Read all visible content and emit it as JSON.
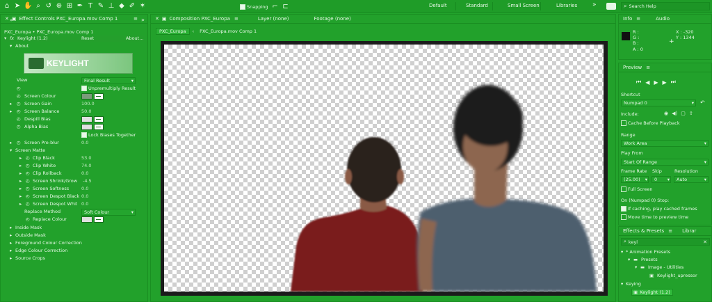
{
  "toolbar": {
    "snapping": "Snapping",
    "workspaces": [
      "Default",
      "Standard",
      "Small Screen",
      "Libraries"
    ],
    "more": "»",
    "search_placeholder": "Search Help"
  },
  "effect_controls": {
    "tab": "Effect Controls PXC_Europa.mov Comp 1",
    "breadcrumb": "PXC_Europa • PXC_Europa.mov Comp 1",
    "effect_name": "Keylight (1.2)",
    "reset": "Reset",
    "about": "About...",
    "about_label": "About",
    "logo": "KEYLIGHT",
    "view_label": "View",
    "view_value": "Final Result",
    "unpremultiply": "Unpremultiply Result",
    "screen_colour": "Screen Colour",
    "screen_gain": "Screen Gain",
    "screen_gain_val": "100.0",
    "screen_balance": "Screen Balance",
    "screen_balance_val": "50.0",
    "despill_bias": "Despill Bias",
    "alpha_bias": "Alpha Bias",
    "lock_biases": "Lock Biases Together",
    "screen_preblur": "Screen Pre-blur",
    "screen_preblur_val": "0.0",
    "screen_matte": "Screen Matte",
    "clip_black": "Clip Black",
    "clip_black_val": "53.0",
    "clip_white": "Clip White",
    "clip_white_val": "74.0",
    "clip_rollback": "Clip Rollback",
    "clip_rollback_val": "0.0",
    "screen_shrink": "Screen Shrink/Grow",
    "screen_shrink_val": "-4.5",
    "screen_softness": "Screen Softness",
    "screen_softness_val": "0.0",
    "despot_black": "Screen Despot Black",
    "despot_black_val": "0.0",
    "despot_white": "Screen Despot White",
    "despot_white_val": "0.0",
    "replace_method": "Replace Method",
    "replace_method_val": "Soft Colour",
    "replace_colour": "Replace Colour",
    "inside_mask": "Inside Mask",
    "outside_mask": "Outside Mask",
    "fg_colour_correction": "Foreground Colour Correction",
    "edge_colour_correction": "Edge Colour Correction",
    "source_crops": "Source Crops"
  },
  "composition": {
    "tab": "Composition PXC_Europa",
    "layer_tab": "Layer (none)",
    "footage_tab": "Footage (none)",
    "sub_tabs": [
      "PXC_Europa",
      "PXC_Europa.mov Comp 1"
    ]
  },
  "info": {
    "tab_info": "Info",
    "tab_audio": "Audio",
    "r": "R :",
    "g": "G :",
    "b": "B :",
    "a": "A : 0",
    "x": "X : -320",
    "y": "Y : 1344"
  },
  "preview": {
    "title": "Preview",
    "shortcut_label": "Shortcut",
    "shortcut_val": "Numpad 0",
    "include_label": "Include:",
    "cache_before": "Cache Before Playback",
    "range_label": "Range",
    "range_val": "Work Area",
    "play_from_label": "Play From",
    "play_from_val": "Start Of Range",
    "frame_rate_label": "Frame Rate",
    "skip_label": "Skip",
    "resolution_label": "Resolution",
    "frame_rate_val": "(25.00)",
    "skip_val": "0",
    "resolution_val": "Auto",
    "full_screen": "Full Screen",
    "on_stop": "On (Numpad 0) Stop:",
    "if_caching": "If caching, play cached frames",
    "move_time": "Move time to preview time"
  },
  "effects_presets": {
    "tab": "Effects & Presets",
    "tab2": "Librar",
    "search_value": "keyl",
    "tree": [
      "* Animation Presets",
      "Presets",
      "Image - Utilities",
      "Keylight_upressor",
      "Keying",
      "Keylight (1.2)"
    ]
  }
}
